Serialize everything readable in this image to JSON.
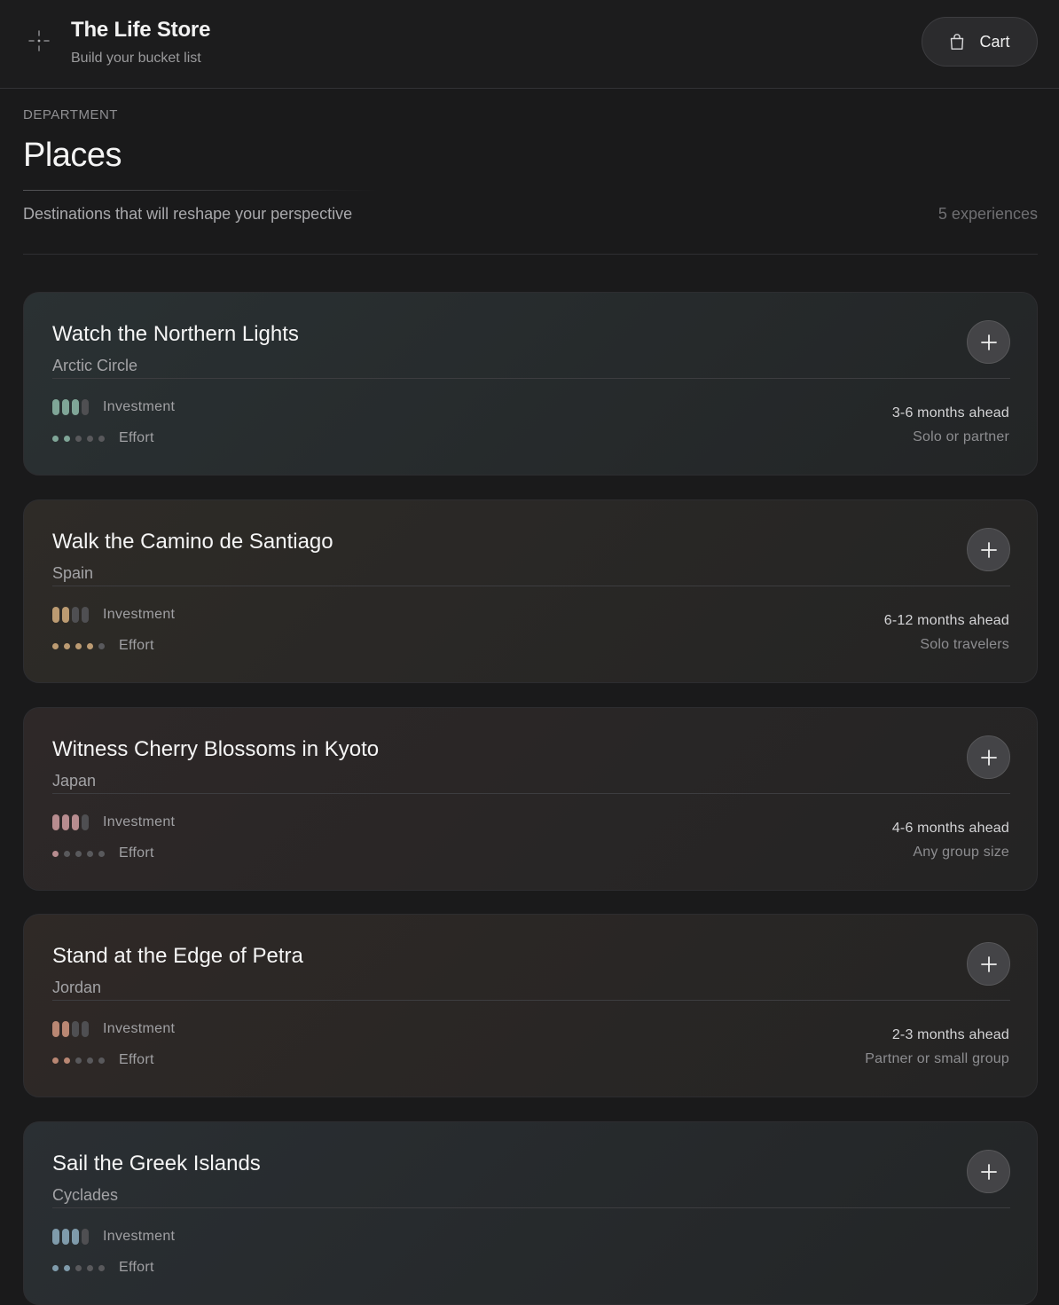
{
  "header": {
    "title": "The Life Store",
    "subtitle": "Build your bucket list",
    "logo_icon": "sparkle-crosshair-icon",
    "cart_label": "Cart",
    "cart_icon": "shopping-bag-icon"
  },
  "department": {
    "label": "DEPARTMENT",
    "title": "Places",
    "description": "Destinations that will reshape your perspective",
    "count": "5 experiences"
  },
  "labels": {
    "investment": "Investment",
    "effort": "Effort"
  },
  "cards": [
    {
      "title": "Watch the Northern Lights",
      "location": "Arctic Circle",
      "investment_level": 3,
      "investment_max": 4,
      "effort_level": 2,
      "effort_max": 5,
      "timeframe": "3-6 months ahead",
      "group": "Solo or partner",
      "accent": "#7fa597",
      "bg_from": "#2a3133",
      "bg_to": "#232526"
    },
    {
      "title": "Walk the Camino de Santiago",
      "location": "Spain",
      "investment_level": 2,
      "investment_max": 4,
      "effort_level": 4,
      "effort_max": 5,
      "timeframe": "6-12 months ahead",
      "group": "Solo travelers",
      "accent": "#bc9b72",
      "bg_from": "#2e2b27",
      "bg_to": "#242424"
    },
    {
      "title": "Witness Cherry Blossoms in Kyoto",
      "location": "Japan",
      "investment_level": 3,
      "investment_max": 4,
      "effort_level": 1,
      "effort_max": 5,
      "timeframe": "4-6 months ahead",
      "group": "Any group size",
      "accent": "#b78c8f",
      "bg_from": "#2e2828",
      "bg_to": "#242424"
    },
    {
      "title": "Stand at the Edge of Petra",
      "location": "Jordan",
      "investment_level": 2,
      "investment_max": 4,
      "effort_level": 2,
      "effort_max": 5,
      "timeframe": "2-3 months ahead",
      "group": "Partner or small group",
      "accent": "#b98773",
      "bg_from": "#2f2926",
      "bg_to": "#242424"
    },
    {
      "title": "Sail the Greek Islands",
      "location": "Cyclades",
      "investment_level": 3,
      "investment_max": 4,
      "effort_level": 2,
      "effort_max": 5,
      "timeframe": "",
      "group": "",
      "accent": "#7f9bab",
      "bg_from": "#2a2f33",
      "bg_to": "#232526"
    }
  ]
}
